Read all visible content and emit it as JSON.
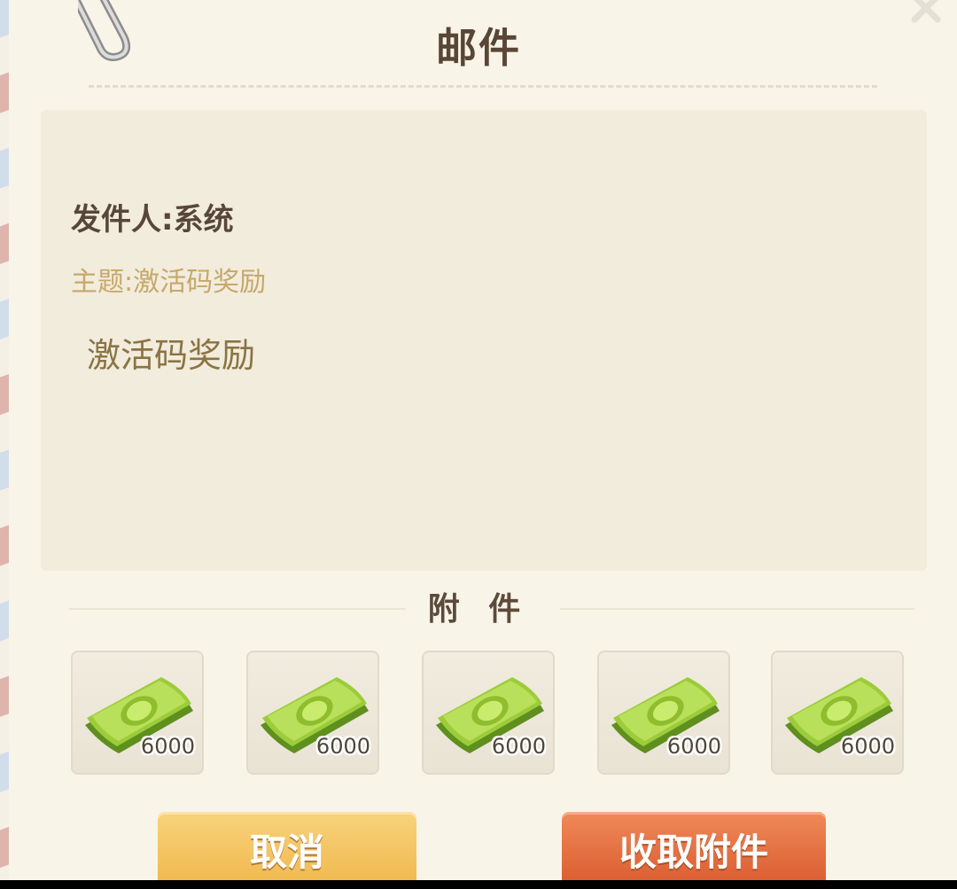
{
  "header": {
    "title": "邮件"
  },
  "mail": {
    "sender": "发件人:系统",
    "subject": "主题:激活码奖励",
    "body": "激活码奖励"
  },
  "attachments": {
    "title": "附 件",
    "items": [
      {
        "icon": "cash-icon",
        "count": "6000"
      },
      {
        "icon": "cash-icon",
        "count": "6000"
      },
      {
        "icon": "cash-icon",
        "count": "6000"
      },
      {
        "icon": "cash-icon",
        "count": "6000"
      },
      {
        "icon": "cash-icon",
        "count": "6000"
      }
    ]
  },
  "buttons": {
    "cancel": "取消",
    "collect": "收取附件"
  },
  "colors": {
    "paper": "#f8f4e8",
    "title_text": "#5a4636",
    "subject_text": "#c7a86a",
    "cancel_button": "#efb64a",
    "collect_button": "#d9582e"
  }
}
